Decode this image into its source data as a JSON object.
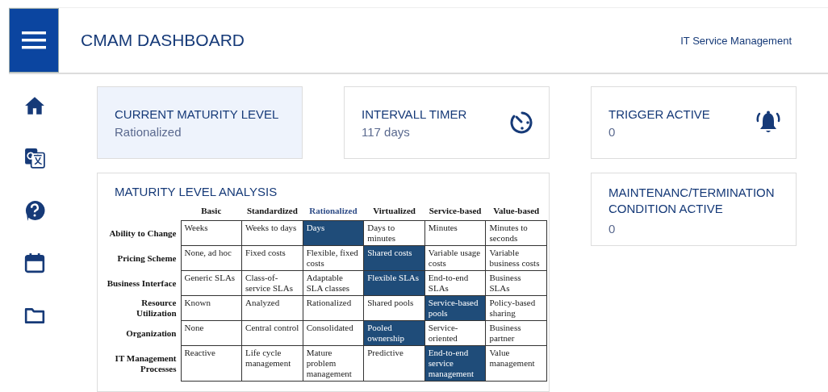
{
  "header": {
    "title": "CMAM DASHBOARD",
    "subtitle": "IT Service Management"
  },
  "sidebar": {
    "items": [
      {
        "kind": "home"
      },
      {
        "kind": "translate"
      },
      {
        "kind": "help"
      },
      {
        "kind": "calendar"
      },
      {
        "kind": "folder"
      }
    ]
  },
  "cards": [
    {
      "title": "CURRENT MATURITY LEVEL",
      "value": "Rationalized",
      "highlighted": true,
      "kind": "plain"
    },
    {
      "title": "INTERVALL TIMER",
      "value": "117 days",
      "highlighted": false,
      "kind": "timer"
    },
    {
      "title": "TRIGGER ACTIVE",
      "value": "0",
      "highlighted": false,
      "kind": "bell"
    },
    {
      "title": "MAINTENANC/TERMINATION CONDITION ACTIVE",
      "value": "0",
      "highlighted": false,
      "kind": "plain"
    }
  ],
  "analysis": {
    "title": "MATURITY LEVEL ANALYSIS",
    "columns": [
      {
        "label": "Basic",
        "selected": false
      },
      {
        "label": "Standardized",
        "selected": false
      },
      {
        "label": "Rationalized",
        "selected": true
      },
      {
        "label": "Virtualized",
        "selected": false
      },
      {
        "label": "Service-based",
        "selected": false
      },
      {
        "label": "Value-based",
        "selected": false
      }
    ],
    "rows": [
      {
        "label": "Ability to Change",
        "cells": [
          {
            "text": "Weeks",
            "highlighted": false
          },
          {
            "text": "Weeks to days",
            "highlighted": false
          },
          {
            "text": "Days",
            "highlighted": true
          },
          {
            "text": "Days to minutes",
            "highlighted": false
          },
          {
            "text": "Minutes",
            "highlighted": false
          },
          {
            "text": "Minutes to seconds",
            "highlighted": false
          }
        ]
      },
      {
        "label": "Pricing Scheme",
        "cells": [
          {
            "text": "None, ad hoc",
            "highlighted": false
          },
          {
            "text": "Fixed costs",
            "highlighted": false
          },
          {
            "text": "Flexible, fixed costs",
            "highlighted": false
          },
          {
            "text": "Shared costs",
            "highlighted": true
          },
          {
            "text": "Variable usage costs",
            "highlighted": false
          },
          {
            "text": "Variable business costs",
            "highlighted": false
          }
        ]
      },
      {
        "label": "Business Interface",
        "cells": [
          {
            "text": "Generic SLAs",
            "highlighted": false
          },
          {
            "text": "Class-of-service SLAs",
            "highlighted": false
          },
          {
            "text": "Adaptable SLA classes",
            "highlighted": false
          },
          {
            "text": "Flexible SLAs",
            "highlighted": true
          },
          {
            "text": "End-to-end SLAs",
            "highlighted": false
          },
          {
            "text": "Business SLAs",
            "highlighted": false
          }
        ]
      },
      {
        "label": "Resource Utilization",
        "cells": [
          {
            "text": "Known",
            "highlighted": false
          },
          {
            "text": "Analyzed",
            "highlighted": false
          },
          {
            "text": "Rationalized",
            "highlighted": false
          },
          {
            "text": "Shared pools",
            "highlighted": false
          },
          {
            "text": "Service-based pools",
            "highlighted": true
          },
          {
            "text": "Policy-based sharing",
            "highlighted": false
          }
        ]
      },
      {
        "label": "Organization",
        "cells": [
          {
            "text": "None",
            "highlighted": false
          },
          {
            "text": "Central control",
            "highlighted": false
          },
          {
            "text": "Consolidated",
            "highlighted": false
          },
          {
            "text": "Pooled ownership",
            "highlighted": true
          },
          {
            "text": "Service-oriented",
            "highlighted": false
          },
          {
            "text": "Business partner",
            "highlighted": false
          }
        ]
      },
      {
        "label": "IT Management Processes",
        "cells": [
          {
            "text": "Reactive",
            "highlighted": false
          },
          {
            "text": "Life cycle management",
            "highlighted": false
          },
          {
            "text": "Mature problem management",
            "highlighted": false
          },
          {
            "text": "Predictive",
            "highlighted": false
          },
          {
            "text": "End-to-end service management",
            "highlighted": true
          },
          {
            "text": "Value management",
            "highlighted": false
          }
        ]
      }
    ]
  }
}
